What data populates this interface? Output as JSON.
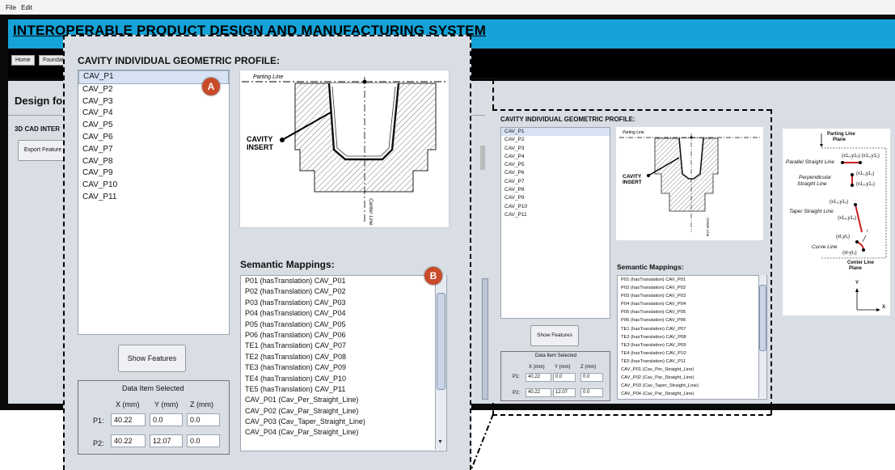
{
  "menu": {
    "file": "File",
    "edit": "Edit"
  },
  "app": {
    "title": "INTEROPERABLE PRODUCT DESIGN AND MANUFACTURING SYSTEM",
    "nav": [
      "Home",
      "Foundati"
    ],
    "design_heading": "Design for",
    "cad_heading": "3D CAD INTER",
    "export_button": "Export Feature"
  },
  "panel": {
    "heading": "CAVITY INDIVIDUAL GEOMETRIC PROFILE:",
    "profiles": [
      "CAV_P1",
      "CAV_P2",
      "CAV_P3",
      "CAV_P4",
      "CAV_P5",
      "CAV_P6",
      "CAV_P7",
      "CAV_P8",
      "CAV_P9",
      "CAV_P10",
      "CAV_P11"
    ],
    "selected_profile": "CAV_P1",
    "drawing": {
      "parting_line": "Parting Line",
      "cavity_insert_1": "CAVITY",
      "cavity_insert_2": "INSERT",
      "center_line": "Center Line"
    },
    "semantic_heading": "Semantic Mappings:",
    "mappings": [
      "P01 (hasTranslation) CAV_P01",
      "P02 (hasTranslation) CAV_P02",
      "P03 (hasTranslation) CAV_P03",
      "P04 (hasTranslation) CAV_P04",
      "P05 (hasTranslation) CAV_P05",
      "P06 (hasTranslation) CAV_P06",
      "TE1 (hasTranslation) CAV_P07",
      "TE2 (hasTranslation) CAV_P08",
      "TE3 (hasTranslation) CAV_P09",
      "TE4 (hasTranslation) CAV_P10",
      "TE5 (hasTranslation) CAV_P11",
      "CAV_P01 (Cav_Per_Straight_Line)",
      "CAV_P02 (Cav_Par_Straight_Line)",
      "CAV_P03 (Cav_Taper_Straight_Line)",
      "CAV_P04 (Cav_Par_Straight_Line)"
    ],
    "show_features": "Show Features",
    "data_item": {
      "title": "Data Item Selected",
      "cols": [
        "X (mm)",
        "Y (mm)",
        "Z (mm)"
      ],
      "rows": [
        {
          "label": "P1:",
          "x": "40.22",
          "y": "0.0",
          "z": "0.0"
        },
        {
          "label": "P2:",
          "x": "40.22",
          "y": "12.07",
          "z": "0.0"
        }
      ]
    }
  },
  "badges": {
    "a": "A",
    "b": "B"
  },
  "legend": {
    "parting_line_plane_1": "Parting Line",
    "parting_line_plane_2": "Plane",
    "parallel": "Parallel Straight Line",
    "perpendicular_1": "Perpendicular",
    "perpendicular_2": "Straight Line",
    "taper": "Taper Straight Line",
    "curve": "Curve Line",
    "center_line_plane_1": "Center Line",
    "center_line_plane_2": "Plane",
    "pt_parallel": "(x1ₒ,y1ₒ) (x1₁,y1₁)",
    "pt_perp_1": "(x1₁,y1₁)",
    "pt_perp_2": "(x1₂,y1₂)",
    "pt_taper_1": "(x1₃,y1₃)",
    "pt_taper_2": "(x1₄,y1₄)",
    "pt_curve_1": "(xt,yt₁)",
    "pt_curve_2": "(xt-yt₂)",
    "r": "r",
    "axis_y": "Y",
    "axis_x": "X"
  },
  "colors": {
    "title_bar": "#15a3d8",
    "badge": "#c94b2a",
    "selection": "#d7e3f4",
    "legend_segment": "#cc1f1f"
  }
}
